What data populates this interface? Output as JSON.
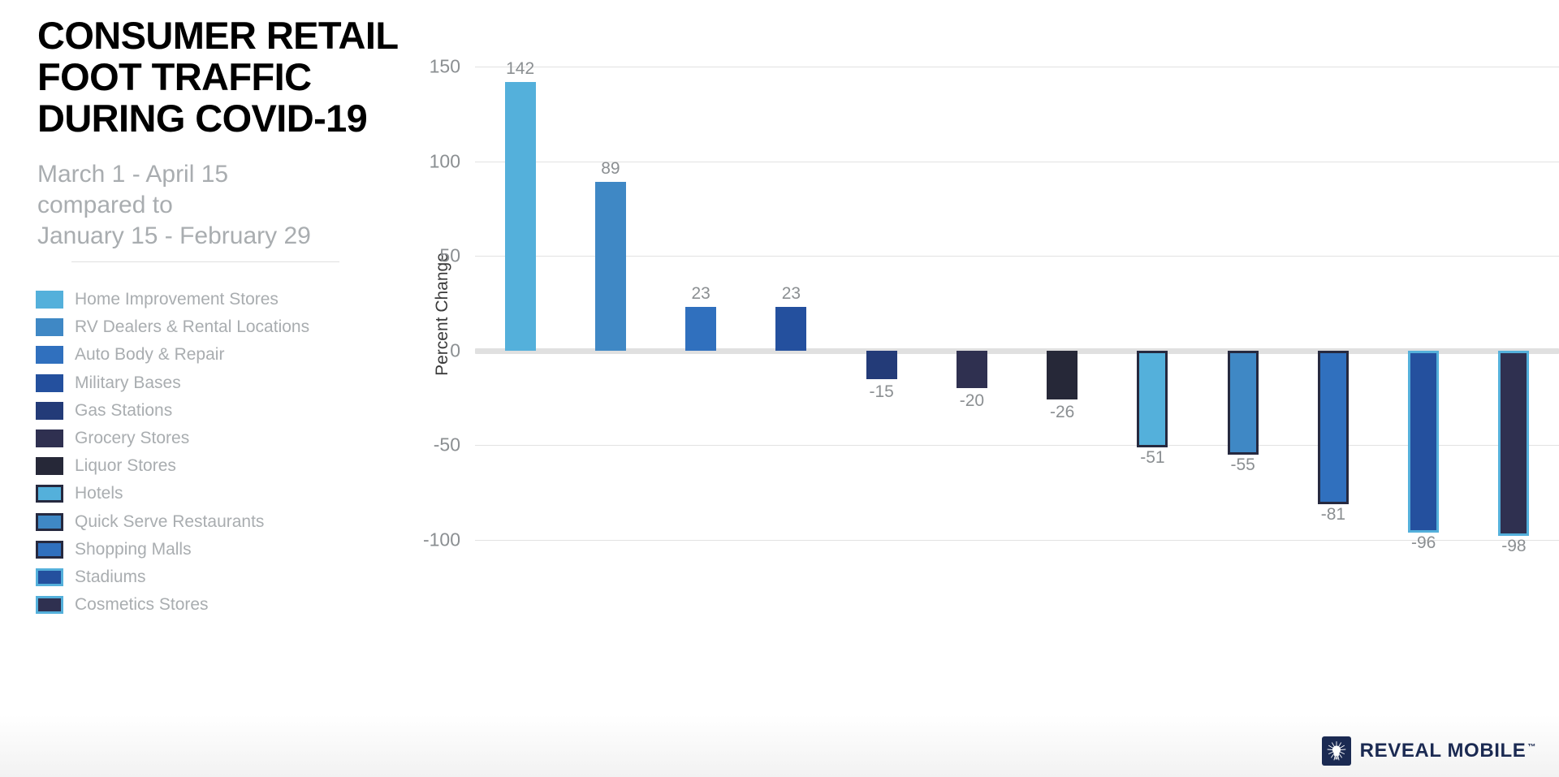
{
  "header": {
    "title": "CONSUMER RETAIL FOOT TRAFFIC DURING COVID-19",
    "title_line1": "CONSUMER RETAIL",
    "title_line2": "FOOT TRAFFIC",
    "title_line3": "DURING COVID-19",
    "subtitle_line1": "March 1 - April 15",
    "subtitle_line2": "compared to",
    "subtitle_line3": "January 15 - February 29"
  },
  "legend": {
    "items": [
      {
        "label": "Home Improvement Stores",
        "color": "#54b0db",
        "border": "none"
      },
      {
        "label": "RV Dealers & Rental Locations",
        "color": "#3f88c5",
        "border": "none"
      },
      {
        "label": "Auto Body & Repair",
        "color": "#3070be",
        "border": "none"
      },
      {
        "label": "Military Bases",
        "color": "#24509e",
        "border": "none"
      },
      {
        "label": "Gas Stations",
        "color": "#233b78",
        "border": "none"
      },
      {
        "label": "Grocery Stores",
        "color": "#2f3050",
        "border": "none"
      },
      {
        "label": "Liquor Stores",
        "color": "#262838",
        "border": "none"
      },
      {
        "label": "Hotels",
        "color": "#54b0db",
        "border": "#26293f"
      },
      {
        "label": "Quick Serve Restaurants",
        "color": "#3f88c5",
        "border": "#26293f"
      },
      {
        "label": "Shopping Malls",
        "color": "#3070be",
        "border": "#26293f"
      },
      {
        "label": "Stadiums",
        "color": "#24509e",
        "border": "#54b0db"
      },
      {
        "label": "Cosmetics Stores",
        "color": "#2f3050",
        "border": "#54b0db"
      }
    ]
  },
  "logo": {
    "text": "REVEAL MOBILE",
    "trademark": "™",
    "mark_name": "reveal-mobile-lightbulb-mark"
  },
  "chart_data": {
    "type": "bar",
    "title": "CONSUMER RETAIL FOOT TRAFFIC DURING COVID-19",
    "subtitle": "March 1 - April 15 compared to January 15 - February 29",
    "xlabel": "",
    "ylabel": "Percent Change",
    "ylim": [
      -100,
      150
    ],
    "yticks": [
      150,
      100,
      50,
      0,
      -50,
      -100
    ],
    "ytick_labels": [
      "150",
      "100",
      "50",
      "0",
      "-50",
      "-100"
    ],
    "grid": true,
    "legend_position": "left",
    "categories": [
      "Home Improvement Stores",
      "RV Dealers & Rental Locations",
      "Auto Body & Repair",
      "Military Bases",
      "Gas Stations",
      "Grocery Stores",
      "Liquor Stores",
      "Hotels",
      "Quick Serve Restaurants",
      "Shopping Malls",
      "Stadiums",
      "Cosmetics Stores"
    ],
    "values": [
      142,
      89,
      23,
      23,
      -15,
      -20,
      -26,
      -51,
      -55,
      -81,
      -96,
      -98
    ],
    "value_labels": [
      "142",
      "89",
      "23",
      "23",
      "-15",
      "-20",
      "-26",
      "-51",
      "-55",
      "-81",
      "-96",
      "-98"
    ],
    "colors": [
      "#54b0db",
      "#3f88c5",
      "#3070be",
      "#24509e",
      "#233b78",
      "#2f3050",
      "#262838",
      "#54b0db",
      "#3f88c5",
      "#3070be",
      "#24509e",
      "#2f3050"
    ],
    "borders": [
      "none",
      "none",
      "none",
      "none",
      "none",
      "none",
      "none",
      "#26293f",
      "#26293f",
      "#26293f",
      "#54b0db",
      "#54b0db"
    ]
  }
}
